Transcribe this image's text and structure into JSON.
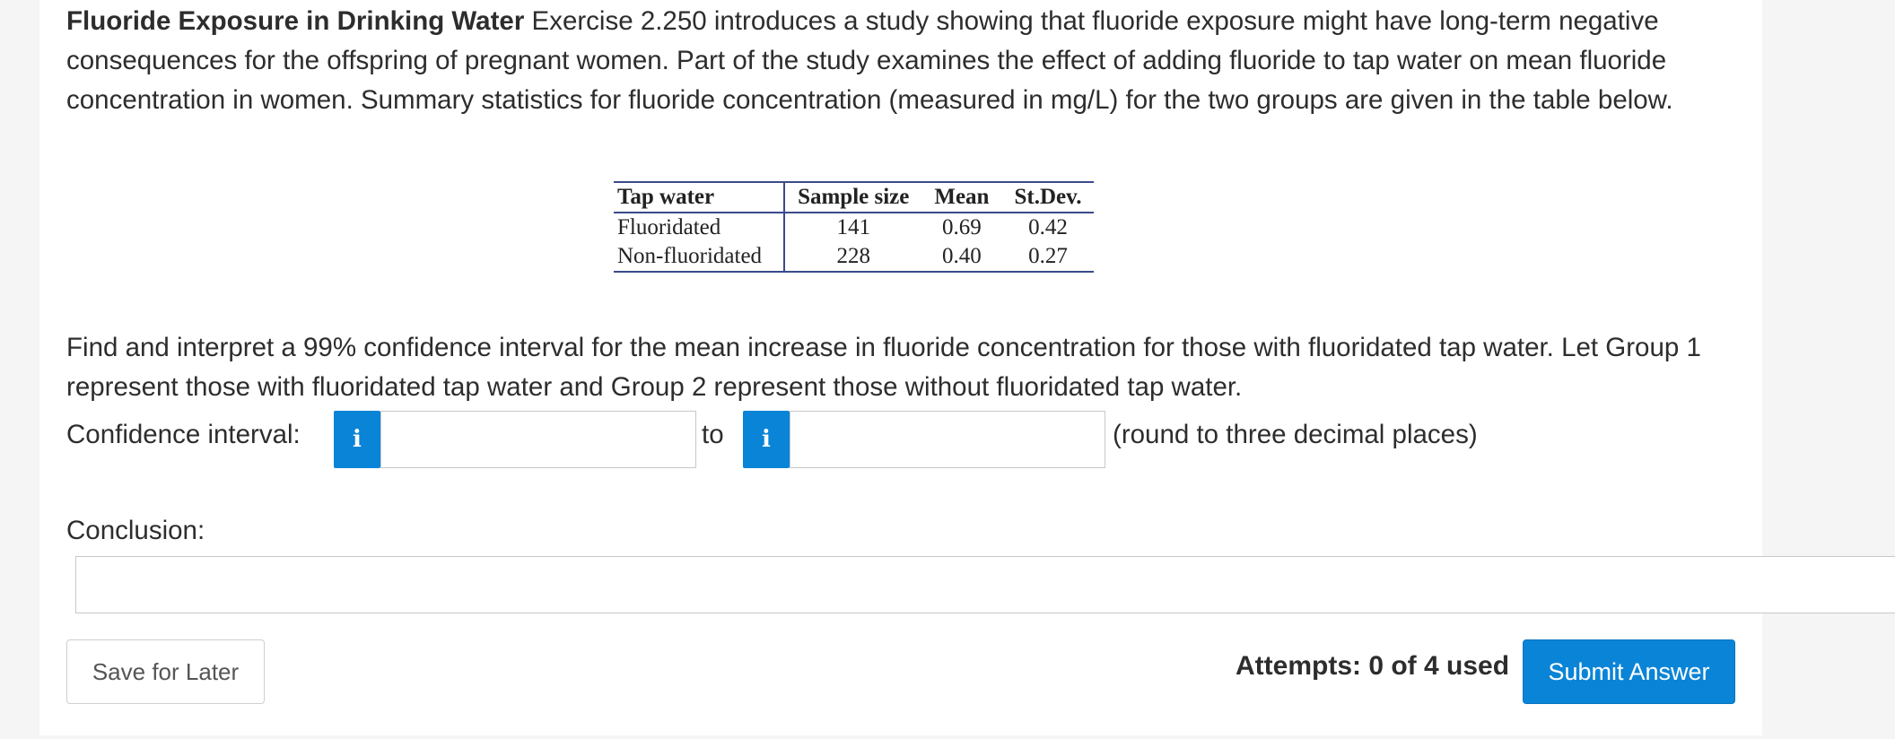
{
  "problem": {
    "title": "Fluoride Exposure in Drinking Water",
    "text": "Exercise 2.250 introduces a study showing that fluoride exposure might have long-term negative consequences for the offspring of pregnant women. Part of the study examines the effect of adding fluoride to tap water on mean fluoride concentration in women. Summary statistics for fluoride concentration (measured in mg/L) for the two groups are given in the table below."
  },
  "table": {
    "headers": [
      "Tap water",
      "Sample size",
      "Mean",
      "St.Dev."
    ],
    "rows": [
      [
        "Fluoridated",
        "141",
        "0.69",
        "0.42"
      ],
      [
        "Non-fluoridated",
        "228",
        "0.40",
        "0.27"
      ]
    ]
  },
  "question": {
    "text": "Find and interpret a 99% confidence interval for the mean increase in fluoride concentration for those with fluoridated tap water. Let Group 1 represent those with fluoridated tap water and Group 2 represent those without fluoridated tap water."
  },
  "ci": {
    "label": "Confidence interval:",
    "info_icon_glyph": "i",
    "lower_value": "",
    "to_label": "to",
    "upper_value": "",
    "round_note": "(round to three decimal places)"
  },
  "conclusion": {
    "label": "Conclusion:",
    "value": ""
  },
  "footer": {
    "save_label": "Save for Later",
    "attempts": "Attempts: 0 of 4 used",
    "submit_label": "Submit Answer"
  },
  "colors": {
    "accent": "#0a84d6",
    "table_rule": "#3a4a8a"
  }
}
